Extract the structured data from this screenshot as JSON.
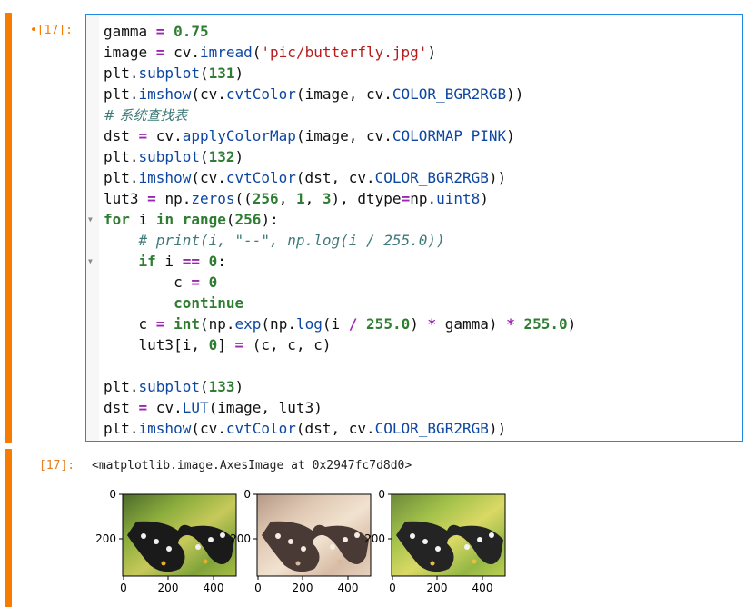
{
  "input_cell": {
    "prompt": "[17]:",
    "prompt_marker": "•",
    "code_lines": [
      [
        {
          "t": "gamma "
        },
        {
          "t": "=",
          "c": "op"
        },
        {
          "t": " "
        },
        {
          "t": "0.75",
          "c": "num"
        }
      ],
      [
        {
          "t": "image "
        },
        {
          "t": "=",
          "c": "op"
        },
        {
          "t": " cv."
        },
        {
          "t": "imread",
          "c": "fn"
        },
        {
          "t": "("
        },
        {
          "t": "'pic/butterfly.jpg'",
          "c": "str"
        },
        {
          "t": ")"
        }
      ],
      [
        {
          "t": "plt."
        },
        {
          "t": "subplot",
          "c": "fn"
        },
        {
          "t": "("
        },
        {
          "t": "131",
          "c": "num"
        },
        {
          "t": ")"
        }
      ],
      [
        {
          "t": "plt."
        },
        {
          "t": "imshow",
          "c": "fn"
        },
        {
          "t": "(cv."
        },
        {
          "t": "cvtColor",
          "c": "fn"
        },
        {
          "t": "(image, cv."
        },
        {
          "t": "COLOR_BGR2RGB",
          "c": "fn"
        },
        {
          "t": "))"
        }
      ],
      [
        {
          "t": "# 系统查找表",
          "c": "com-cjk"
        }
      ],
      [
        {
          "t": "dst "
        },
        {
          "t": "=",
          "c": "op"
        },
        {
          "t": " cv."
        },
        {
          "t": "applyColorMap",
          "c": "fn"
        },
        {
          "t": "(image, cv."
        },
        {
          "t": "COLORMAP_PINK",
          "c": "fn"
        },
        {
          "t": ")"
        }
      ],
      [
        {
          "t": "plt."
        },
        {
          "t": "subplot",
          "c": "fn"
        },
        {
          "t": "("
        },
        {
          "t": "132",
          "c": "num"
        },
        {
          "t": ")"
        }
      ],
      [
        {
          "t": "plt."
        },
        {
          "t": "imshow",
          "c": "fn"
        },
        {
          "t": "(cv."
        },
        {
          "t": "cvtColor",
          "c": "fn"
        },
        {
          "t": "(dst, cv."
        },
        {
          "t": "COLOR_BGR2RGB",
          "c": "fn"
        },
        {
          "t": "))"
        }
      ],
      [
        {
          "t": "lut3 "
        },
        {
          "t": "=",
          "c": "op"
        },
        {
          "t": " np."
        },
        {
          "t": "zeros",
          "c": "fn"
        },
        {
          "t": "(("
        },
        {
          "t": "256",
          "c": "num"
        },
        {
          "t": ", "
        },
        {
          "t": "1",
          "c": "num"
        },
        {
          "t": ", "
        },
        {
          "t": "3",
          "c": "num"
        },
        {
          "t": "), dtype"
        },
        {
          "t": "=",
          "c": "op"
        },
        {
          "t": "np."
        },
        {
          "t": "uint8",
          "c": "fn"
        },
        {
          "t": ")"
        }
      ],
      [
        {
          "t": "for",
          "c": "kw"
        },
        {
          "t": " i "
        },
        {
          "t": "in",
          "c": "kw"
        },
        {
          "t": " "
        },
        {
          "t": "range",
          "c": "kw"
        },
        {
          "t": "("
        },
        {
          "t": "256",
          "c": "num"
        },
        {
          "t": "):"
        }
      ],
      [
        {
          "t": "    "
        },
        {
          "t": "# print(i, \"--\", np.log(i / 255.0))",
          "c": "com"
        }
      ],
      [
        {
          "t": "    "
        },
        {
          "t": "if",
          "c": "kw"
        },
        {
          "t": " i "
        },
        {
          "t": "==",
          "c": "op"
        },
        {
          "t": " "
        },
        {
          "t": "0",
          "c": "num"
        },
        {
          "t": ":"
        }
      ],
      [
        {
          "t": "        c "
        },
        {
          "t": "=",
          "c": "op"
        },
        {
          "t": " "
        },
        {
          "t": "0",
          "c": "num"
        }
      ],
      [
        {
          "t": "        "
        },
        {
          "t": "continue",
          "c": "kw"
        }
      ],
      [
        {
          "t": "    c "
        },
        {
          "t": "=",
          "c": "op"
        },
        {
          "t": " "
        },
        {
          "t": "int",
          "c": "kw"
        },
        {
          "t": "(np."
        },
        {
          "t": "exp",
          "c": "fn"
        },
        {
          "t": "(np."
        },
        {
          "t": "log",
          "c": "fn"
        },
        {
          "t": "(i "
        },
        {
          "t": "/",
          "c": "op"
        },
        {
          "t": " "
        },
        {
          "t": "255.0",
          "c": "num"
        },
        {
          "t": ") "
        },
        {
          "t": "*",
          "c": "op"
        },
        {
          "t": " gamma) "
        },
        {
          "t": "*",
          "c": "op"
        },
        {
          "t": " "
        },
        {
          "t": "255.0",
          "c": "num"
        },
        {
          "t": ")"
        }
      ],
      [
        {
          "t": "    lut3[i, "
        },
        {
          "t": "0",
          "c": "num"
        },
        {
          "t": "] "
        },
        {
          "t": "=",
          "c": "op"
        },
        {
          "t": " (c, c, c)"
        }
      ],
      [
        {
          "t": ""
        }
      ],
      [
        {
          "t": "plt."
        },
        {
          "t": "subplot",
          "c": "fn"
        },
        {
          "t": "("
        },
        {
          "t": "133",
          "c": "num"
        },
        {
          "t": ")"
        }
      ],
      [
        {
          "t": "dst "
        },
        {
          "t": "=",
          "c": "op"
        },
        {
          "t": " cv."
        },
        {
          "t": "LUT",
          "c": "fn"
        },
        {
          "t": "(image, lut3)"
        }
      ],
      [
        {
          "t": "plt."
        },
        {
          "t": "imshow",
          "c": "fn"
        },
        {
          "t": "(cv."
        },
        {
          "t": "cvtColor",
          "c": "fn"
        },
        {
          "t": "(dst, cv."
        },
        {
          "t": "COLOR_BGR2RGB",
          "c": "fn"
        },
        {
          "t": "))"
        }
      ]
    ]
  },
  "output_cell": {
    "prompt": "[17]:",
    "text": "<matplotlib.image.AxesImage at 0x2947fc7d8d0>",
    "subplots": [
      {
        "name": "original",
        "y_ticks": [
          "0",
          "200"
        ],
        "x_ticks": [
          "0",
          "200",
          "400"
        ]
      },
      {
        "name": "colormap-pink",
        "y_ticks": [
          "0",
          "200"
        ],
        "x_ticks": [
          "0",
          "200",
          "400"
        ]
      },
      {
        "name": "lut-gamma",
        "y_ticks": [
          "0",
          "200"
        ],
        "x_ticks": [
          "0",
          "200",
          "400"
        ]
      }
    ]
  },
  "colors": {
    "cell_bar": "#f57c00",
    "editor_border": "#1e88e5",
    "operator": "#9c27b0",
    "number": "#2e7d32",
    "string": "#b71c1c",
    "function": "#0d47a1",
    "comment": "#3e7a78"
  }
}
